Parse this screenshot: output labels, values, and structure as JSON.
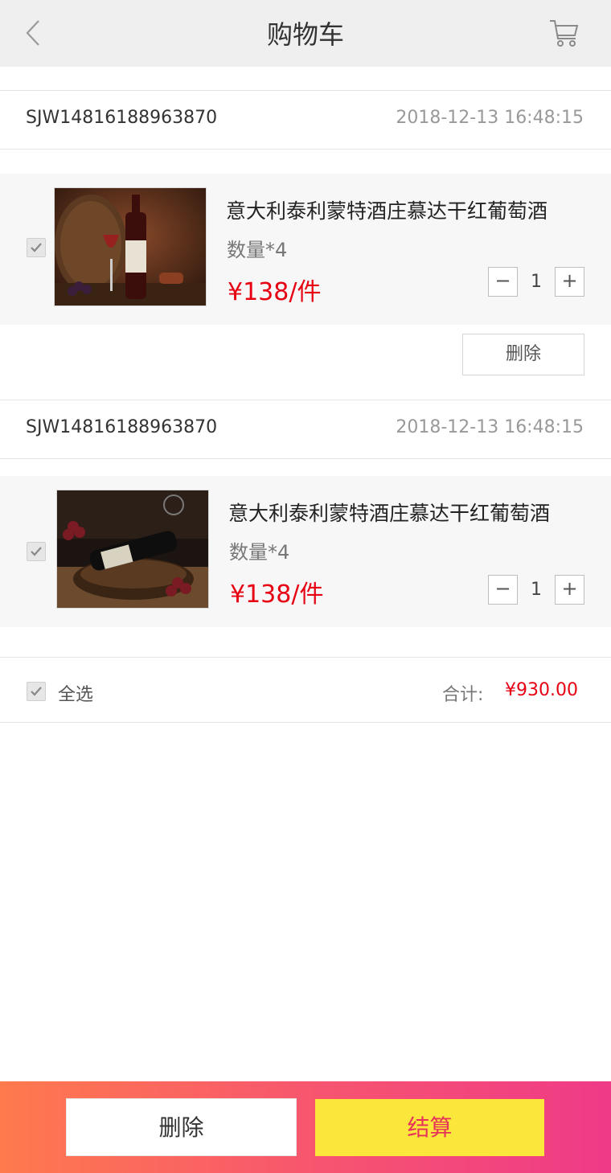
{
  "header": {
    "title": "购物车",
    "back_icon": "chevron-left-icon",
    "cart_icon": "cart-icon"
  },
  "orders": [
    {
      "order_id": "SJW14816188963870",
      "time": "2018-12-13 16:48:15",
      "item": {
        "name": "意大利泰利蒙特酒庄慕达干红葡萄酒",
        "qty_text": "数量*4",
        "price": "¥138/件",
        "quantity": "1",
        "minus": "−",
        "plus": "+",
        "checked": true
      },
      "delete_label": "删除"
    },
    {
      "order_id": "SJW14816188963870",
      "time": "2018-12-13 16:48:15",
      "item": {
        "name": "意大利泰利蒙特酒庄慕达干红葡萄酒",
        "qty_text": "数量*4",
        "price": "¥138/件",
        "quantity": "1",
        "minus": "−",
        "plus": "+",
        "checked": true
      }
    }
  ],
  "summary": {
    "select_all_label": "全选",
    "total_label": "合计:",
    "total_value": "¥930.00",
    "checked": true
  },
  "footer": {
    "delete_label": "删除",
    "checkout_label": "结算"
  },
  "colors": {
    "price": "#e60012",
    "header_bg": "#efefef",
    "checkout_bg": "#fbe73b",
    "checkout_text": "#e6335a"
  }
}
